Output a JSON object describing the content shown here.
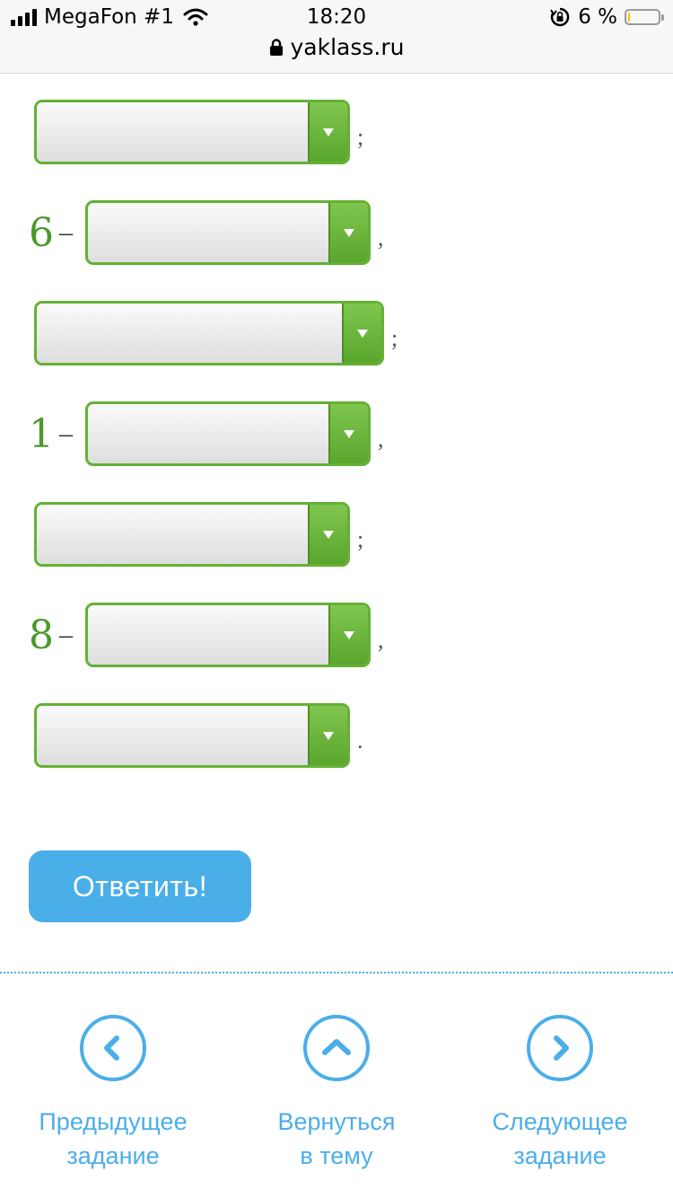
{
  "status_bar": {
    "carrier": "MegaFon #1",
    "time": "18:20",
    "battery": "6 %",
    "url": "yaklass.ru"
  },
  "rows": [
    {
      "prefix": "",
      "punct": ";"
    },
    {
      "prefix": "6",
      "punct": ","
    },
    {
      "prefix": "",
      "punct": ";"
    },
    {
      "prefix": "1",
      "punct": ","
    },
    {
      "prefix": "",
      "punct": ";"
    },
    {
      "prefix": "8",
      "punct": ","
    },
    {
      "prefix": "",
      "punct": "."
    }
  ],
  "dash": "–",
  "answer_button": "Ответить!",
  "nav": {
    "prev": {
      "line1": "Предыдущее",
      "line2": "задание",
      "icon": "chevron-left-icon"
    },
    "back": {
      "line1": "Вернуться",
      "line2": "в тему",
      "icon": "chevron-up-icon"
    },
    "next": {
      "line1": "Следующее",
      "line2": "задание",
      "icon": "chevron-right-icon"
    }
  },
  "colors": {
    "accent": "#4aaee9",
    "select_border": "#64b134",
    "number": "#4a9a2a"
  }
}
